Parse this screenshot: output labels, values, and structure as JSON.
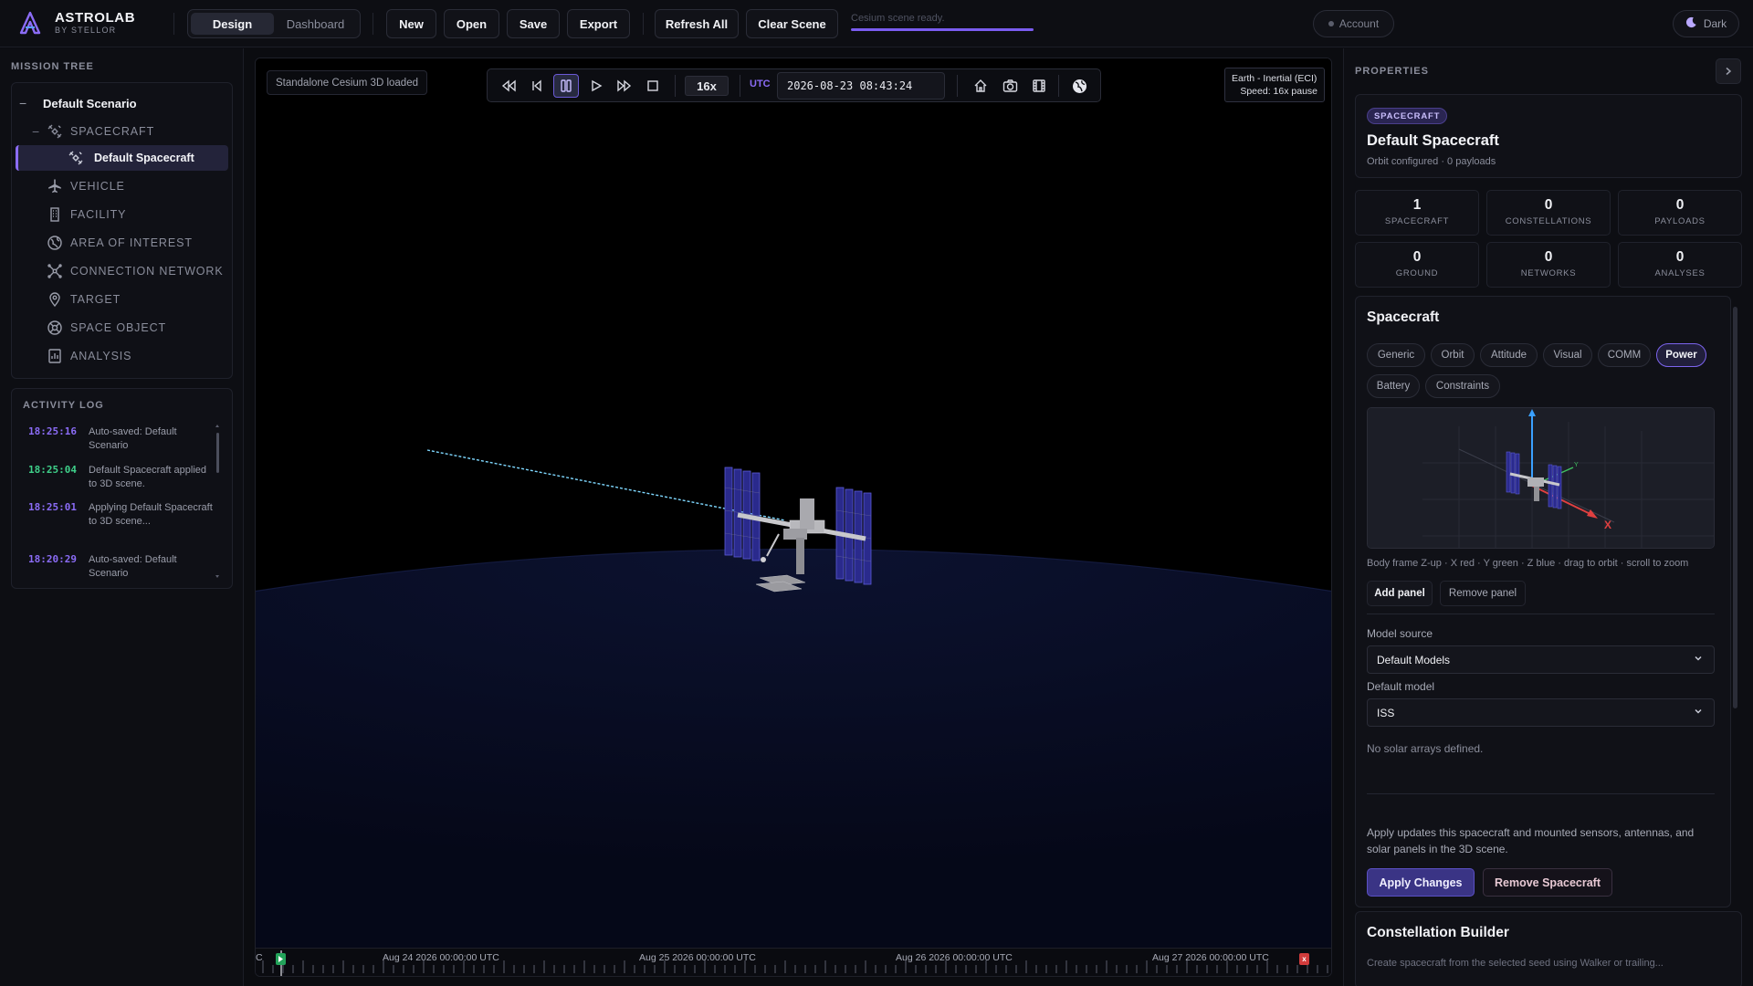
{
  "brand": {
    "name": "ASTROLAB",
    "subtitle": "BY STELLOR"
  },
  "mode_tabs": [
    {
      "label": "Design",
      "active": true
    },
    {
      "label": "Dashboard",
      "active": false
    }
  ],
  "toolbar": {
    "new": "New",
    "open": "Open",
    "save": "Save",
    "export": "Export",
    "refresh_all": "Refresh All",
    "clear_scene": "Clear Scene"
  },
  "status": {
    "text": "Cesium scene ready.",
    "progress": 1.0,
    "color": "#7a5cf0"
  },
  "account": {
    "label": "Account"
  },
  "theme": {
    "label": "Dark"
  },
  "mission_tree": {
    "title": "MISSION TREE",
    "root": {
      "label": "Default Scenario",
      "toggle": "−"
    },
    "categories": [
      {
        "label": "SPACECRAFT",
        "icon": "satellite-icon",
        "toggle": "−"
      },
      {
        "label": "VEHICLE",
        "icon": "airplane-icon"
      },
      {
        "label": "FACILITY",
        "icon": "building-icon"
      },
      {
        "label": "AREA OF INTEREST",
        "icon": "globe-icon"
      },
      {
        "label": "CONNECTION NETWORK",
        "icon": "network-icon"
      },
      {
        "label": "TARGET",
        "icon": "pin-icon"
      },
      {
        "label": "SPACE OBJECT",
        "icon": "orbit-icon"
      },
      {
        "label": "ANALYSIS",
        "icon": "chart-icon"
      }
    ],
    "selected_child": {
      "label": "Default Spacecraft",
      "icon": "satellite-icon"
    }
  },
  "activity_log": {
    "title": "ACTIVITY LOG",
    "entries": [
      {
        "time": "18:25:16",
        "message": "Auto-saved: Default Scenario",
        "color": "#8b6cf6"
      },
      {
        "time": "18:25:04",
        "message": "Default Spacecraft applied to 3D scene.",
        "color": "#3fd08a"
      },
      {
        "time": "18:25:01",
        "message": "Applying Default Spacecraft to 3D scene...",
        "color": "#8b6cf6"
      },
      {
        "time": "18:20:29",
        "message": "Auto-saved: Default Scenario",
        "color": "#8b6cf6"
      }
    ]
  },
  "viewport": {
    "scene_status": "Standalone Cesium 3D loaded",
    "playback": {
      "speed": "16x",
      "utc_label": "UTC",
      "datetime": "2026-08-23 08:43:24",
      "paused": true
    },
    "frame_info": {
      "line1": "Earth - Inertial (ECI)",
      "line2": "Speed: 16x pause"
    },
    "timeline": {
      "start_label": "C",
      "labels": [
        "Aug 24 2026 00:00:00 UTC",
        "Aug 25 2026 00:00:00 UTC",
        "Aug 26 2026 00:00:00 UTC",
        "Aug 27 2026 00:00:00 UTC"
      ],
      "end_marker": "x"
    }
  },
  "properties": {
    "title": "PROPERTIES",
    "badge": "SPACECRAFT",
    "name": "Default Spacecraft",
    "subtitle": "Orbit configured · 0 payloads",
    "stats": [
      {
        "value": "1",
        "label": "SPACECRAFT"
      },
      {
        "value": "0",
        "label": "CONSTELLATIONS"
      },
      {
        "value": "0",
        "label": "PAYLOADS"
      },
      {
        "value": "0",
        "label": "GROUND"
      },
      {
        "value": "0",
        "label": "NETWORKS"
      },
      {
        "value": "0",
        "label": "ANALYSES"
      }
    ]
  },
  "spacecraft_editor": {
    "title": "Spacecraft",
    "tabs": [
      {
        "label": "Generic",
        "active": false
      },
      {
        "label": "Orbit",
        "active": false
      },
      {
        "label": "Attitude",
        "active": false
      },
      {
        "label": "Visual",
        "active": false
      },
      {
        "label": "COMM",
        "active": false
      },
      {
        "label": "Power",
        "active": true
      },
      {
        "label": "Battery",
        "active": false
      },
      {
        "label": "Constraints",
        "active": false
      }
    ],
    "preview_axis_x": "X",
    "preview_caption": "Body frame Z-up · X red · Y green · Z blue · drag to orbit · scroll to zoom",
    "add_panel": "Add panel",
    "remove_panel": "Remove panel",
    "model_source_label": "Model source",
    "model_source_value": "Default Models",
    "default_model_label": "Default model",
    "default_model_value": "ISS",
    "empty_note": "No solar arrays defined.",
    "apply_note": "Apply updates this spacecraft and mounted sensors, antennas, and solar panels in the 3D scene.",
    "apply_button": "Apply Changes",
    "remove_button": "Remove Spacecraft"
  },
  "constellation_builder": {
    "title": "Constellation Builder",
    "text": "Create spacecraft from the selected seed using Walker or trailing..."
  }
}
